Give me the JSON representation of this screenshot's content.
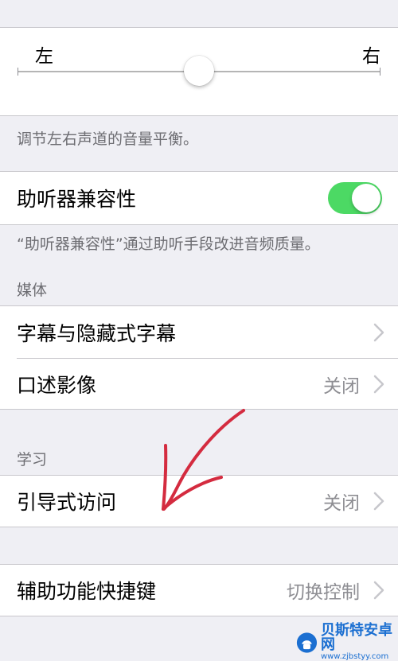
{
  "balance": {
    "left_label": "左",
    "right_label": "右",
    "value": 0.5,
    "footnote": "调节左右声道的音量平衡。"
  },
  "hearing_aid": {
    "label": "助听器兼容性",
    "enabled": true,
    "footnote": "“助听器兼容性”通过助听手段改进音频质量。"
  },
  "media": {
    "header": "媒体",
    "items": [
      {
        "label": "字幕与隐藏式字幕",
        "detail": ""
      },
      {
        "label": "口述影像",
        "detail": "关闭"
      }
    ]
  },
  "learning": {
    "header": "学习",
    "items": [
      {
        "label": "引导式访问",
        "detail": "关闭"
      }
    ]
  },
  "shortcut": {
    "label": "辅助功能快捷键",
    "detail": "切换控制"
  },
  "colors": {
    "toggle_on": "#4cd964",
    "annotation_arrow": "#d42b3f",
    "background": "#efeff4"
  },
  "watermark": {
    "text": "贝斯特安卓网",
    "url": "www.zjbstyy.com"
  }
}
